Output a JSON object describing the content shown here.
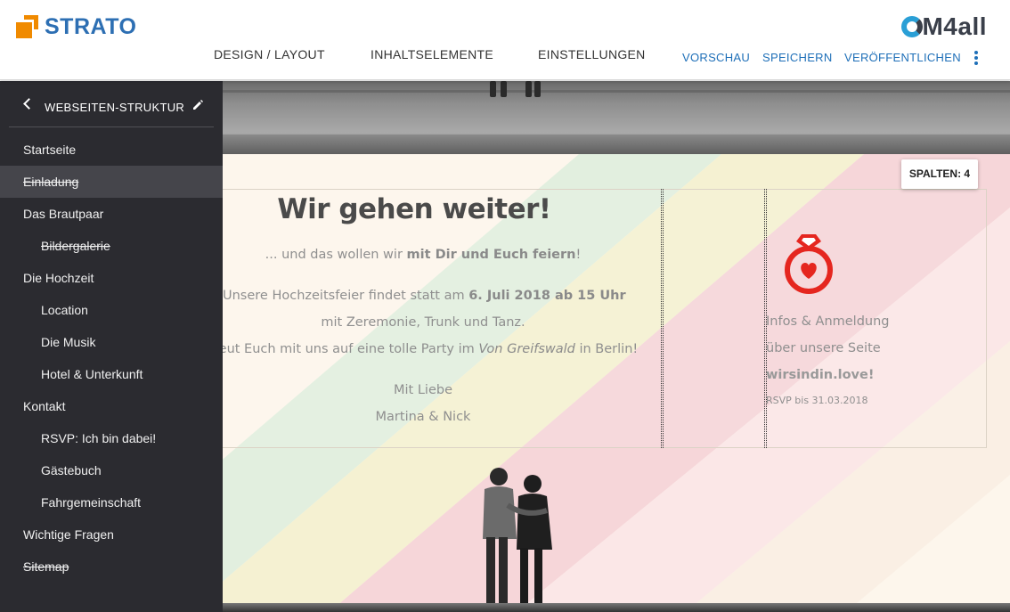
{
  "brand": {
    "left_logo": "STRATO",
    "right_logo": "M4all"
  },
  "nav": {
    "items": [
      "DESIGN / LAYOUT",
      "INHALTSELEMENTE",
      "EINSTELLUNGEN"
    ],
    "actions": [
      "VORSCHAU",
      "SPEICHERN",
      "VERÖFFENTLICHEN"
    ]
  },
  "sidebar": {
    "title": "WEBSEITEN-STRUKTUR",
    "items": [
      {
        "label": "Startseite",
        "level": 0,
        "active": false,
        "strike": false
      },
      {
        "label": "Einladung",
        "level": 0,
        "active": true,
        "strike": true
      },
      {
        "label": "Das Brautpaar",
        "level": 0,
        "active": false,
        "strike": false
      },
      {
        "label": "Bildergalerie",
        "level": 1,
        "active": false,
        "strike": true
      },
      {
        "label": "Die Hochzeit",
        "level": 0,
        "active": false,
        "strike": false
      },
      {
        "label": "Location",
        "level": 1,
        "active": false,
        "strike": false
      },
      {
        "label": "Die Musik",
        "level": 1,
        "active": false,
        "strike": false
      },
      {
        "label": "Hotel & Unterkunft",
        "level": 1,
        "active": false,
        "strike": false
      },
      {
        "label": "Kontakt",
        "level": 0,
        "active": false,
        "strike": false
      },
      {
        "label": "RSVP: Ich bin dabei!",
        "level": 1,
        "active": false,
        "strike": false
      },
      {
        "label": "Gästebuch",
        "level": 1,
        "active": false,
        "strike": false
      },
      {
        "label": "Fahrgemeinschaft",
        "level": 1,
        "active": false,
        "strike": false
      },
      {
        "label": "Wichtige Fragen",
        "level": 0,
        "active": false,
        "strike": false
      },
      {
        "label": "Sitemap",
        "level": 0,
        "active": false,
        "strike": true
      }
    ]
  },
  "editor": {
    "columns_button": "SPALTEN: 4"
  },
  "content": {
    "headline": "Wir gehen weiter!",
    "line1_pre": "... und das wollen wir ",
    "line1_bold": "mit Dir und Euch feiern",
    "line1_post": "!",
    "line2_pre": "Unsere Hochzeitsfeier findet statt am ",
    "line2_bold": "6. Juli 2018 ab 15 Uhr",
    "line3": "mit Zeremonie, Trunk und Tanz.",
    "line4_pre": "reut Euch mit uns auf eine tolle Party im ",
    "line4_italic": "Von Greifswald",
    "line4_post": " in Berlin!",
    "line5": "Mit Liebe",
    "line6": "Martina & Nick"
  },
  "info": {
    "line1": "Infos & Anmeldung",
    "line2": "über unsere Seite",
    "line3": "wirsindin.love!",
    "line4": "RSVP bis 31.03.2018"
  },
  "colors": {
    "accent_orange": "#f08a00",
    "strato_blue": "#2d6fb3",
    "cm4all_cyan": "#2a9fd6",
    "action_blue": "#1e6fb8",
    "sidebar_bg": "#2b2b30",
    "sidebar_active": "#45454b",
    "ring_red": "#e5261f",
    "stripe_green": "#dfeede",
    "stripe_yellow": "#f4f1cf",
    "stripe_pink": "#f6d4d8"
  },
  "icons": {
    "back": "chevron-left-icon",
    "edit": "pencil-icon",
    "more": "vertical-dots-icon",
    "ring": "ring-heart-icon"
  }
}
